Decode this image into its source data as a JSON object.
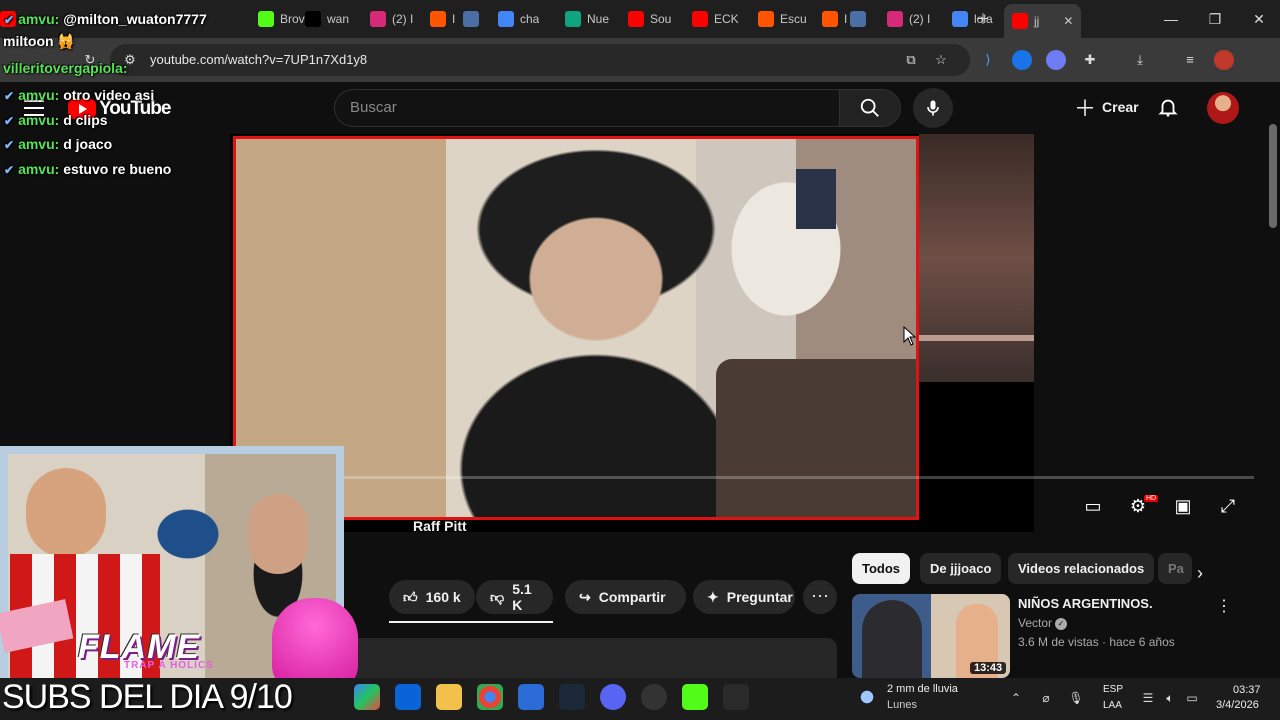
{
  "browser": {
    "tabs": [
      {
        "label": "",
        "icon": "youtube-icon",
        "color": "#ff0000"
      },
      {
        "label": "Brov",
        "icon": "kick-icon",
        "color": "#53fc18"
      },
      {
        "label": "wan",
        "icon": "x-icon",
        "color": "#000000"
      },
      {
        "label": "(2) I",
        "icon": "instagram-icon",
        "color": "#d62976"
      },
      {
        "label": "I",
        "icon": "soundcloud-icon",
        "color": "#ff5500"
      },
      {
        "label": "",
        "icon": "window-icon",
        "color": "#4a6fa5"
      },
      {
        "label": "cha",
        "icon": "google-icon",
        "color": "#4285f4"
      },
      {
        "label": "Nue",
        "icon": "chatgpt-icon",
        "color": "#10a37f"
      },
      {
        "label": "Sou",
        "icon": "youtube-icon",
        "color": "#ff0000"
      },
      {
        "label": "ECK",
        "icon": "youtube-icon",
        "color": "#ff0000"
      },
      {
        "label": "Escu",
        "icon": "soundcloud-icon",
        "color": "#ff5500"
      },
      {
        "label": "I",
        "icon": "soundcloud-icon",
        "color": "#ff5500"
      },
      {
        "label": "",
        "icon": "window-icon",
        "color": "#4a6fa5"
      },
      {
        "label": "(2) I",
        "icon": "instagram-icon",
        "color": "#d62976"
      },
      {
        "label": "lola",
        "icon": "google-icon",
        "color": "#4285f4"
      },
      {
        "label": "jj",
        "icon": "youtube-icon",
        "color": "#ff0000",
        "active": true
      }
    ],
    "url": "youtube.com/watch?v=7UP1n7Xd1y8"
  },
  "youtube": {
    "logo_text": "YouTube",
    "search_placeholder": "Buscar",
    "create_label": "Crear",
    "channel_name": "Raff Pitt",
    "like_count": "160 k",
    "dislike_count": "5.1 K",
    "share_label": "Compartir",
    "ask_label": "Preguntar",
    "chips": [
      {
        "label": "Todos",
        "active": true
      },
      {
        "label": "De jjjoaco",
        "active": false
      },
      {
        "label": "Videos relacionados",
        "active": false
      },
      {
        "label": "Pa",
        "active": false
      }
    ],
    "recommendation": {
      "title": "NIÑOS ARGENTINOS.",
      "channel": "Vector",
      "meta": "3.6 M de vistas · hace 6 años",
      "duration": "13:43"
    },
    "accent_color": "#ff0000"
  },
  "stream_overlay": {
    "chat": [
      {
        "user": "amvu",
        "text": "@milton_wuaton7777"
      },
      {
        "user": "",
        "text": "miltoon 🙀"
      },
      {
        "user": "villeritovergapiola",
        "text": ""
      },
      {
        "user": "amvu",
        "text": "otro video asi"
      },
      {
        "user": "amvu",
        "text": "d clips"
      },
      {
        "user": "amvu",
        "text": "d joaco"
      },
      {
        "user": "amvu",
        "text": "estuvo re bueno"
      }
    ],
    "flame_text": "FLAME",
    "flame_sub": "TRAP A HOLICS",
    "subs_line": "SUBS DEL DIA 9/10"
  },
  "taskbar": {
    "weather_text": "2 mm de lluvia",
    "weather_day": "Lunes",
    "lang_line1": "ESP",
    "lang_line2": "LAA",
    "time": "03:37",
    "date": "3/4/2026"
  }
}
